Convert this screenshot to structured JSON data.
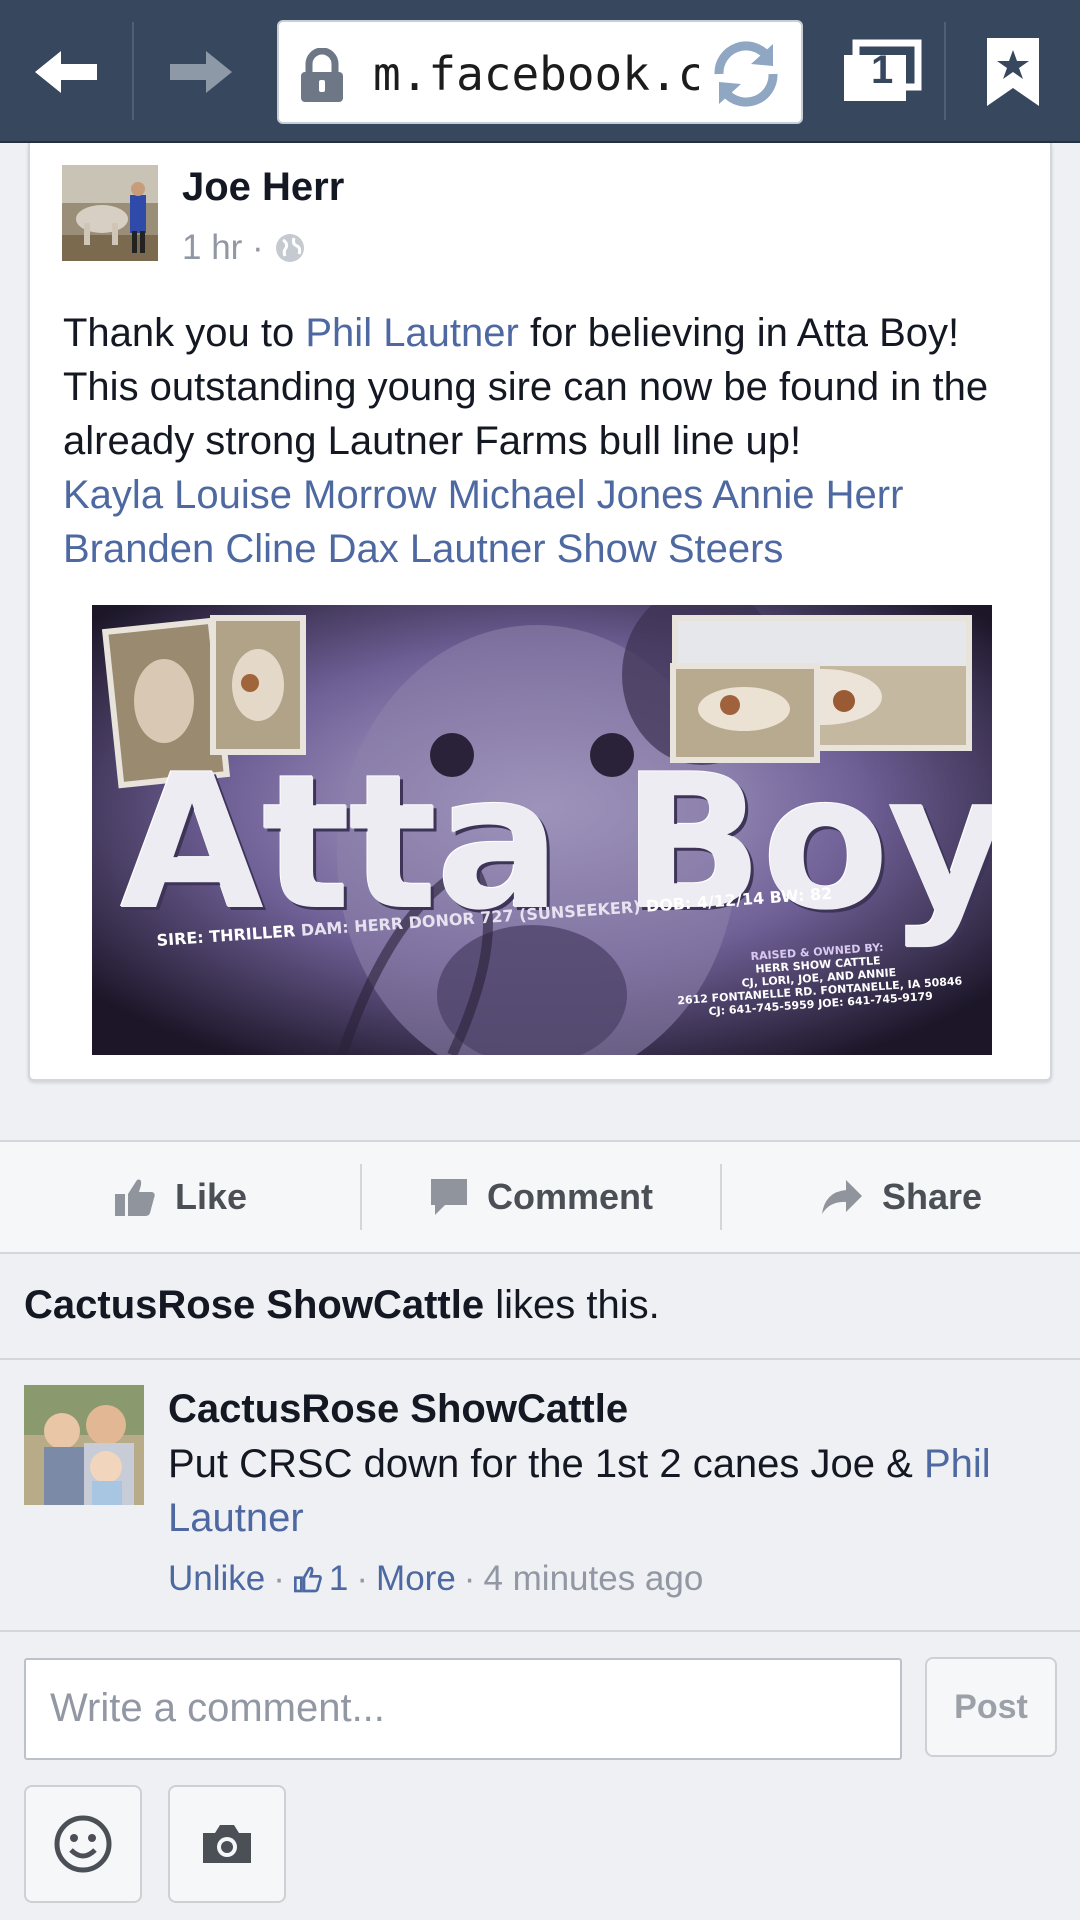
{
  "browser": {
    "url": "m.facebook.co",
    "tab_count": "1",
    "icons": [
      "back-arrow-icon",
      "forward-arrow-icon",
      "lock-icon",
      "reload-icon",
      "tabs-icon",
      "bookmark-star-icon"
    ]
  },
  "post": {
    "author": "Joe Herr",
    "time": "1 hr ·",
    "text_part1": "Thank you to ",
    "mention_1": "Phil Lautner",
    "text_part2": " for believing in Atta Boy! This outstanding young sire can now be found in the already strong Lautner Farms bull line up!",
    "tags": [
      "Kayla Louise Morrow",
      "Michael Jones",
      "Annie Herr",
      "Branden Cline",
      "Dax Lautner Show Steers"
    ],
    "banner": {
      "title": "Atta Boy",
      "pedigree_sire": "SIRE: THRILLER",
      "pedigree_dam": "DAM: HERR DONOR 727 (SUNSEEKER)",
      "pedigree_dob": "DOB: 4/12/14",
      "pedigree_bw": "BW: 82",
      "owner_lines": [
        "RAISED & OWNED BY:",
        "HERR SHOW CATTLE",
        "CJ, LORI, JOE, AND ANNIE",
        "2612 FONTANELLE RD. FONTANELLE, IA 50846",
        "CJ: 641-745-5959  JOE: 641-745-9179"
      ]
    }
  },
  "actions": {
    "like": "Like",
    "comment": "Comment",
    "share": "Share"
  },
  "likes_summary": {
    "name": "CactusRose ShowCattle",
    "suffix": " likes this."
  },
  "comment": {
    "author": "CactusRose ShowCattle",
    "text": "Put CRSC down for the 1st 2 canes Joe & ",
    "mention": "Phil Lautner",
    "unlike": "Unlike",
    "sep1": "·",
    "like_count": "1",
    "sep2": "·",
    "more": "More",
    "sep3": "·",
    "time": "4 minutes ago"
  },
  "composer": {
    "placeholder": "Write a comment...",
    "post_label": "Post"
  },
  "colors": {
    "toolbar": "#37475e",
    "link": "#4e69a2",
    "meta_gray": "#9197a3"
  }
}
